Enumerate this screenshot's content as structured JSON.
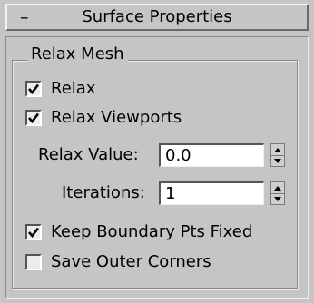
{
  "rollout": {
    "collapse_symbol": "–",
    "title": "Surface Properties"
  },
  "group": {
    "title": "Relax Mesh",
    "relax": {
      "label": "Relax",
      "checked": true
    },
    "relax_viewports": {
      "label": "Relax Viewports",
      "checked": true
    },
    "relax_value": {
      "label": "Relax Value:",
      "value": "0.0"
    },
    "iterations": {
      "label": "Iterations:",
      "value": "1"
    },
    "keep_boundary": {
      "label": "Keep Boundary Pts Fixed",
      "checked": true
    },
    "save_outer_corners": {
      "label": "Save Outer Corners",
      "checked": false
    }
  },
  "icons": {
    "check": "check-mark",
    "spin_up": "triangle-up",
    "spin_down": "triangle-down"
  }
}
